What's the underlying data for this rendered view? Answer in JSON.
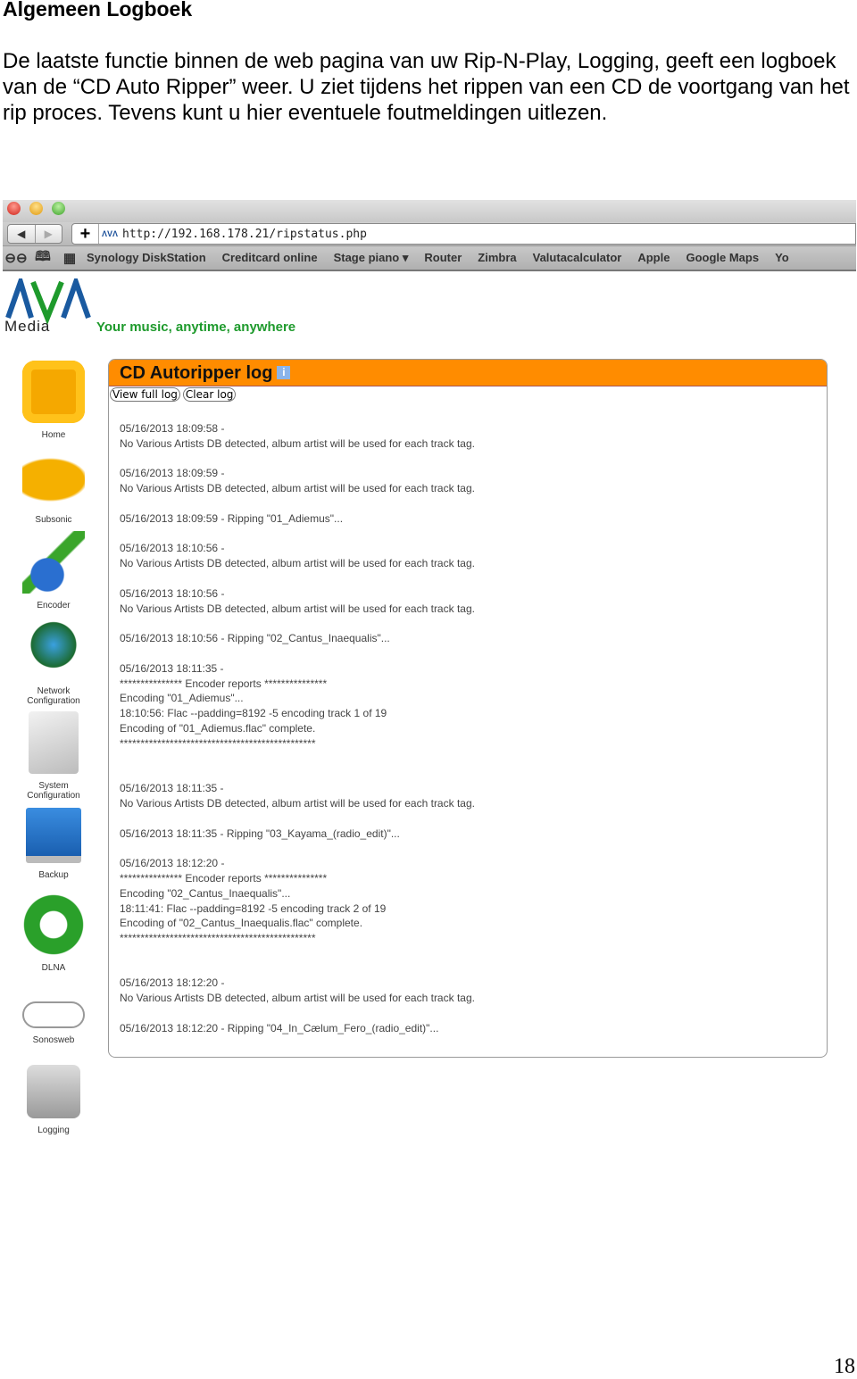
{
  "document": {
    "heading": "Algemeen Logboek",
    "intro": "De laatste functie binnen de web pagina van uw Rip-N-Play, Logging, geeft een logboek van de “CD Auto Ripper” weer. U ziet tijdens het rippen van een CD de voortgang van het rip proces. Tevens kunt u hier eventuele foutmeldingen uitlezen.",
    "page_number": "18"
  },
  "browser": {
    "url": "http://192.168.178.21/ripstatus.php",
    "bookmarks": [
      "Synology DiskStation",
      "Creditcard online",
      "Stage piano ▾",
      "Router",
      "Zimbra",
      "Valutacalculator",
      "Apple",
      "Google Maps",
      "Yo"
    ]
  },
  "site": {
    "logo_text": "Media",
    "tagline": "Your music, anytime, anywhere",
    "accent": "#ff8c00"
  },
  "sidebar": [
    {
      "label": "Home",
      "icon": "home-icon"
    },
    {
      "label": "Subsonic",
      "icon": "submarine-icon"
    },
    {
      "label": "Encoder",
      "icon": "encoder-icon"
    },
    {
      "label": "Network Configuration",
      "icon": "network-globe-icon"
    },
    {
      "label": "System Configuration",
      "icon": "system-tools-icon"
    },
    {
      "label": "Backup",
      "icon": "usb-drive-icon"
    },
    {
      "label": "DLNA",
      "icon": "dlna-icon"
    },
    {
      "label": "Sonosweb",
      "icon": "sonos-icon"
    },
    {
      "label": "Logging",
      "icon": "disk-cd-icon"
    }
  ],
  "panel": {
    "title": "CD Autoripper log",
    "view_full_log": "View full log",
    "clear_log": "Clear log",
    "entries": [
      [
        "05/16/2013 18:09:58 -",
        "No Various Artists DB detected, album artist will be used for each track tag."
      ],
      [
        "05/16/2013 18:09:59 -",
        "No Various Artists DB detected, album artist will be used for each track tag."
      ],
      [
        "05/16/2013 18:09:59 - Ripping \"01_Adiemus\"..."
      ],
      [
        "05/16/2013 18:10:56 -",
        "No Various Artists DB detected, album artist will be used for each track tag."
      ],
      [
        "05/16/2013 18:10:56 -",
        "No Various Artists DB detected, album artist will be used for each track tag."
      ],
      [
        "05/16/2013 18:10:56 - Ripping \"02_Cantus_Inaequalis\"..."
      ],
      [
        "05/16/2013 18:11:35 -",
        "*************** Encoder reports ***************",
        "Encoding \"01_Adiemus\"...",
        "18:10:56: Flac --padding=8192 -5 encoding track 1 of 19",
        "Encoding of \"01_Adiemus.flac\" complete.",
        "***********************************************",
        ""
      ],
      [
        "05/16/2013 18:11:35 -",
        "No Various Artists DB detected, album artist will be used for each track tag."
      ],
      [
        "05/16/2013 18:11:35 - Ripping \"03_Kayama_(radio_edit)\"..."
      ],
      [
        "05/16/2013 18:12:20 -",
        "*************** Encoder reports ***************",
        "Encoding \"02_Cantus_Inaequalis\"...",
        "18:11:41: Flac --padding=8192 -5 encoding track 2 of 19",
        "Encoding of \"02_Cantus_Inaequalis.flac\" complete.",
        "***********************************************",
        ""
      ],
      [
        "05/16/2013 18:12:20 -",
        "No Various Artists DB detected, album artist will be used for each track tag."
      ],
      [
        "05/16/2013 18:12:20 - Ripping \"04_In_Cælum_Fero_(radio_edit)\"..."
      ]
    ]
  }
}
